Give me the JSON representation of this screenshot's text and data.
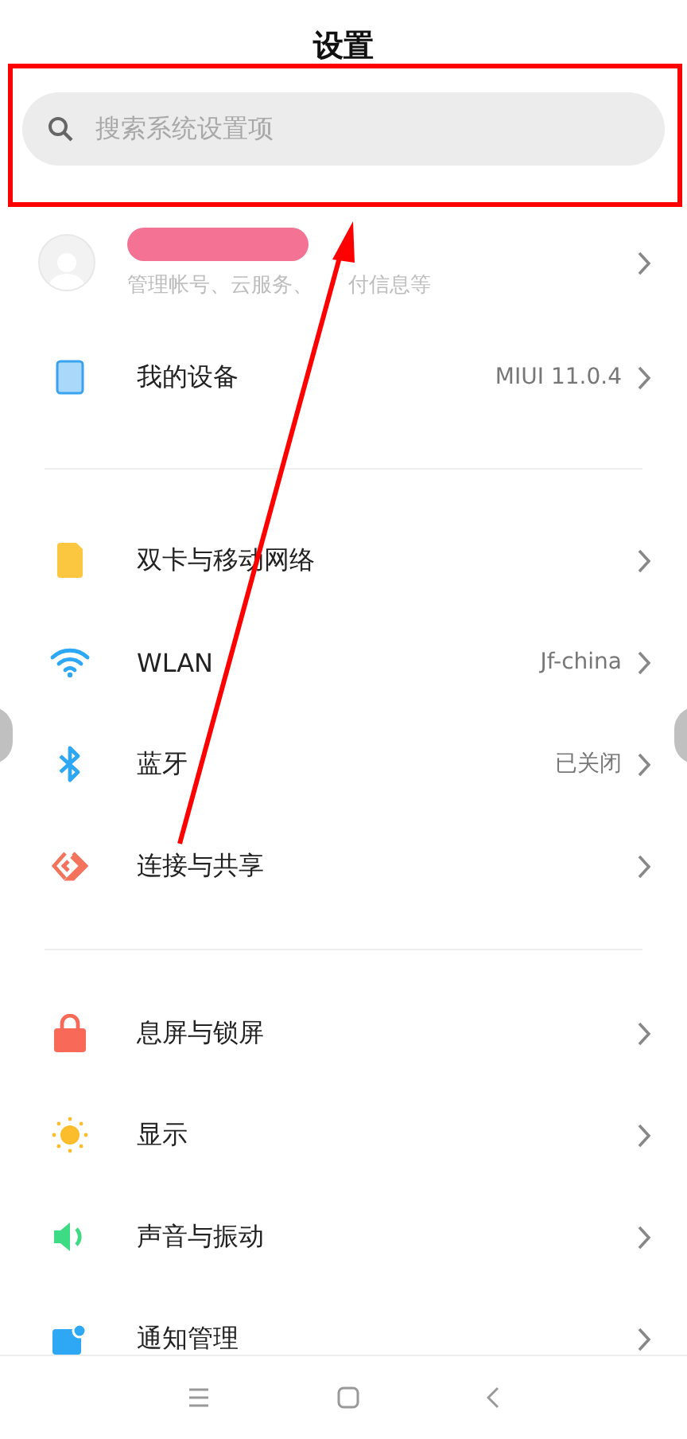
{
  "title": "设置",
  "search": {
    "placeholder": "搜索系统设置项"
  },
  "account": {
    "name_redacted": true,
    "subtitle_parts": [
      "管理帐号、云服务、",
      "付信息等"
    ]
  },
  "groups": [
    {
      "items": [
        {
          "label": "我的设备",
          "value": "MIUI 11.0.4"
        }
      ]
    },
    {
      "items": [
        {
          "label": "双卡与移动网络"
        },
        {
          "label": "WLAN",
          "value": "Jf-china"
        },
        {
          "label": "蓝牙",
          "value": "已关闭"
        },
        {
          "label": "连接与共享"
        }
      ]
    },
    {
      "items": [
        {
          "label": "息屏与锁屏"
        },
        {
          "label": "显示"
        },
        {
          "label": "声音与振动"
        },
        {
          "label": "通知管理"
        }
      ]
    }
  ],
  "annotations": {
    "highlight_box": true,
    "arrow": true
  }
}
